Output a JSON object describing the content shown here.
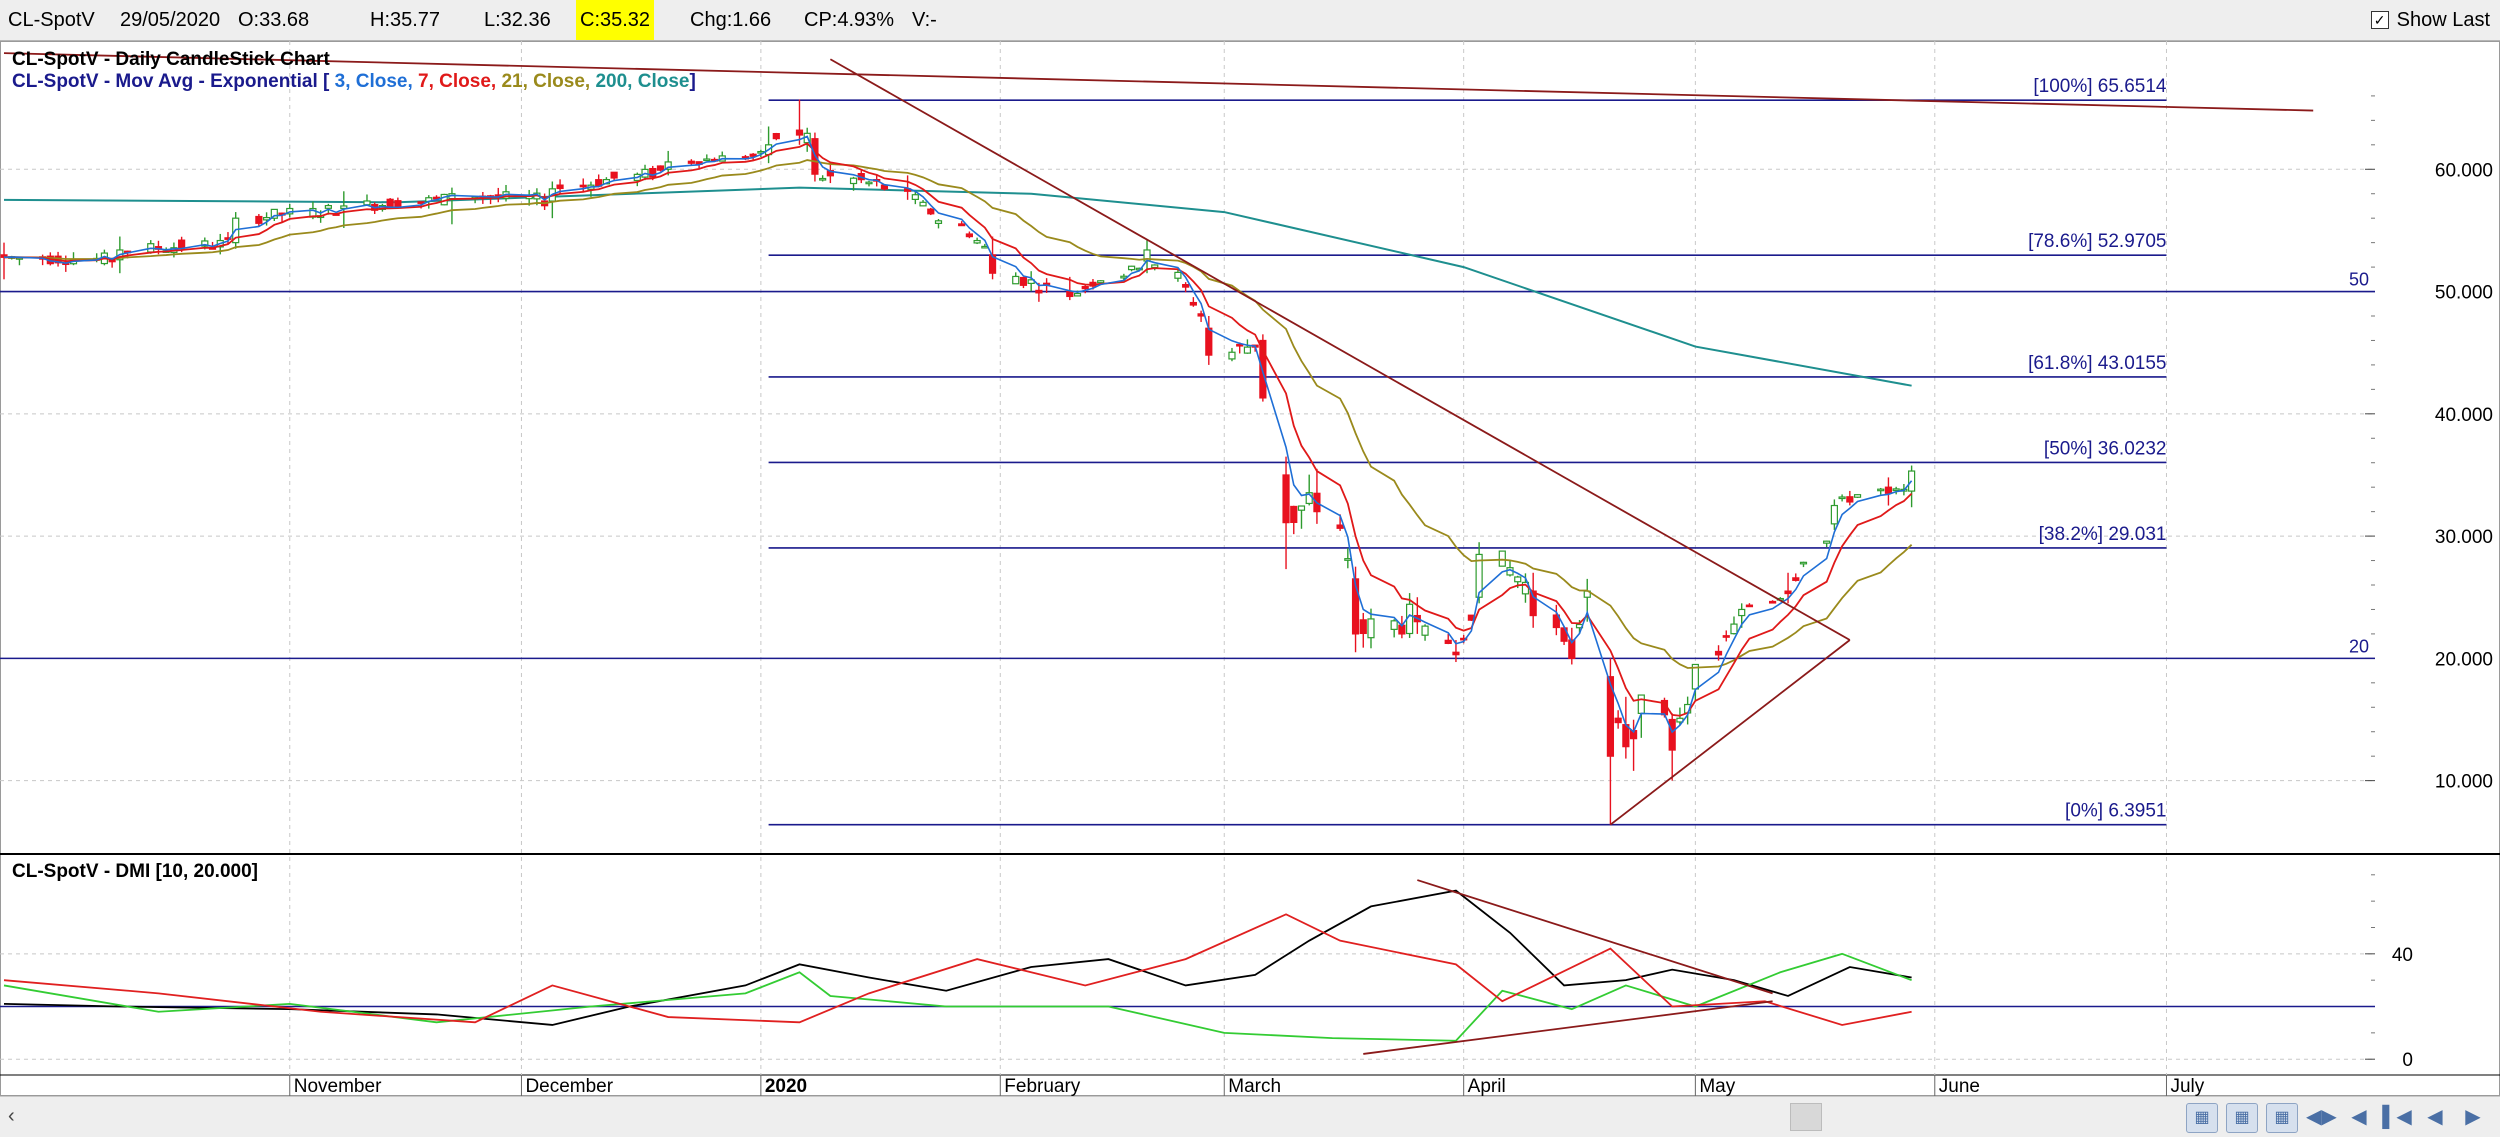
{
  "header": {
    "symbol": "CL-SpotV",
    "date": "29/05/2020",
    "open": "O:33.68",
    "high": "H:35.77",
    "low": "L:32.36",
    "close": "C:35.32",
    "change": "Chg:1.66",
    "change_pct": "CP:4.93%",
    "volume": "V:-",
    "show_last_label": "Show Last",
    "show_last_checked": true
  },
  "colors": {
    "up": "#2e9b2e",
    "down": "#e8111f",
    "ema3": "#1f6fd6",
    "ema7": "#e01919",
    "ema21": "#9a8a1c",
    "ema200": "#1e8f8f",
    "hline": "#1a1a8c",
    "trend": "#8b1a1a",
    "plus_di": "#33cc33",
    "minus_di": "#e02020",
    "adx": "#000000",
    "title_blue": "#1a1a8c"
  },
  "chart_data": [
    {
      "type": "candlestick",
      "title": "CL-SpotV - Daily CandleStick Chart",
      "legend": {
        "prefix": "CL-SpotV - Mov Avg - Exponential [",
        "items": [
          {
            "text": "3, Close,",
            "color": "#1f6fd6"
          },
          {
            "text": "7, Close,",
            "color": "#e01919"
          },
          {
            "text": "21, Close,",
            "color": "#9a8a1c"
          },
          {
            "text": "200, Close",
            "color": "#1e8f8f"
          }
        ],
        "suffix": "]"
      },
      "ylim": [
        4,
        70
      ],
      "y_ticks": [
        10,
        20,
        30,
        40,
        50,
        60
      ],
      "y_tick_labels": [
        "10.000",
        "20.000",
        "30.000",
        "40.000",
        "50.000",
        "60.000"
      ],
      "grid": true,
      "x_start": "2019-09-25",
      "x_end": "2020-07-28",
      "ohlc_anchors": [
        {
          "date": "2019-09-25",
          "open": 53.0,
          "high": 54.0,
          "low": 51.0,
          "close": 52.8
        },
        {
          "date": "2019-10-10",
          "open": 52.6,
          "high": 54.5,
          "low": 51.5,
          "close": 53.4
        },
        {
          "date": "2019-10-25",
          "open": 54.0,
          "high": 56.5,
          "low": 53.5,
          "close": 56.0
        },
        {
          "date": "2019-11-08",
          "open": 56.8,
          "high": 58.2,
          "low": 55.2,
          "close": 57.0
        },
        {
          "date": "2019-11-22",
          "open": 57.6,
          "high": 58.5,
          "low": 55.5,
          "close": 58.0
        },
        {
          "date": "2019-12-05",
          "open": 57.4,
          "high": 59.0,
          "low": 56.0,
          "close": 58.4
        },
        {
          "date": "2019-12-20",
          "open": 60.0,
          "high": 61.5,
          "low": 59.5,
          "close": 60.6
        },
        {
          "date": "2020-01-02",
          "open": 61.2,
          "high": 63.5,
          "low": 60.5,
          "close": 62.0
        },
        {
          "date": "2020-01-06",
          "open": 63.2,
          "high": 65.7,
          "low": 62.0,
          "close": 62.8
        },
        {
          "date": "2020-01-08",
          "open": 62.5,
          "high": 63.0,
          "low": 59.0,
          "close": 59.6
        },
        {
          "date": "2020-01-20",
          "open": 58.4,
          "high": 59.5,
          "low": 57.5,
          "close": 58.2
        },
        {
          "date": "2020-01-31",
          "open": 53.0,
          "high": 54.5,
          "low": 51.0,
          "close": 51.5
        },
        {
          "date": "2020-02-10",
          "open": 50.0,
          "high": 51.2,
          "low": 49.3,
          "close": 49.6
        },
        {
          "date": "2020-02-20",
          "open": 52.5,
          "high": 54.2,
          "low": 51.5,
          "close": 53.4
        },
        {
          "date": "2020-02-28",
          "open": 47.0,
          "high": 48.0,
          "low": 44.0,
          "close": 44.8
        },
        {
          "date": "2020-03-06",
          "open": 46.0,
          "high": 46.5,
          "low": 41.0,
          "close": 41.3
        },
        {
          "date": "2020-03-09",
          "open": 35.0,
          "high": 36.5,
          "low": 27.3,
          "close": 31.1
        },
        {
          "date": "2020-03-13",
          "open": 33.5,
          "high": 35.5,
          "low": 31.0,
          "close": 32.0
        },
        {
          "date": "2020-03-18",
          "open": 26.5,
          "high": 27.5,
          "low": 20.5,
          "close": 22.0
        },
        {
          "date": "2020-03-26",
          "open": 23.5,
          "high": 25.0,
          "low": 22.0,
          "close": 23.0
        },
        {
          "date": "2020-03-31",
          "open": 20.5,
          "high": 21.5,
          "low": 19.7,
          "close": 20.3
        },
        {
          "date": "2020-04-03",
          "open": 25.0,
          "high": 29.5,
          "low": 24.5,
          "close": 28.5
        },
        {
          "date": "2020-04-10",
          "open": 25.5,
          "high": 27.0,
          "low": 22.5,
          "close": 23.5
        },
        {
          "date": "2020-04-15",
          "open": 21.5,
          "high": 22.5,
          "low": 19.5,
          "close": 20.0
        },
        {
          "date": "2020-04-17",
          "open": 25.0,
          "high": 26.5,
          "low": 23.0,
          "close": 25.5
        },
        {
          "date": "2020-04-20",
          "open": 18.5,
          "high": 20.0,
          "low": 6.4,
          "close": 12.0
        },
        {
          "date": "2020-04-24",
          "open": 15.5,
          "high": 17.0,
          "low": 13.5,
          "close": 17.0
        },
        {
          "date": "2020-04-28",
          "open": 15.0,
          "high": 15.5,
          "low": 10.0,
          "close": 12.5
        },
        {
          "date": "2020-05-01",
          "open": 17.5,
          "high": 19.5,
          "low": 16.5,
          "close": 19.5
        },
        {
          "date": "2020-05-07",
          "open": 23.5,
          "high": 24.5,
          "low": 22.5,
          "close": 24.0
        },
        {
          "date": "2020-05-13",
          "open": 25.5,
          "high": 27.0,
          "low": 24.5,
          "close": 25.3
        },
        {
          "date": "2020-05-19",
          "open": 31.0,
          "high": 33.0,
          "low": 30.5,
          "close": 32.5
        },
        {
          "date": "2020-05-26",
          "open": 34.0,
          "high": 34.8,
          "low": 32.5,
          "close": 33.5
        },
        {
          "date": "2020-05-29",
          "open": 33.68,
          "high": 35.77,
          "low": 32.36,
          "close": 35.32
        }
      ],
      "ema200_anchors": [
        {
          "date": "2019-09-25",
          "value": 57.5
        },
        {
          "date": "2019-11-15",
          "value": 57.3
        },
        {
          "date": "2020-01-06",
          "value": 58.5
        },
        {
          "date": "2020-02-05",
          "value": 58.0
        },
        {
          "date": "2020-03-01",
          "value": 56.5
        },
        {
          "date": "2020-04-01",
          "value": 52.0
        },
        {
          "date": "2020-05-01",
          "value": 45.5
        },
        {
          "date": "2020-05-29",
          "value": 42.3
        }
      ],
      "fibonacci": {
        "x_from": "2020-01-02",
        "x_to": "2020-07-01",
        "levels": [
          {
            "label": "[100%] 65.6514",
            "value": 65.6514
          },
          {
            "label": "[78.6%] 52.9705",
            "value": 52.9705
          },
          {
            "label": "[61.8%] 43.0155",
            "value": 43.0155
          },
          {
            "label": "[50%] 36.0232",
            "value": 36.0232
          },
          {
            "label": "[38.2%] 29.031",
            "value": 29.031
          },
          {
            "label": "[0%] 6.3951",
            "value": 6.3951
          }
        ]
      },
      "horizontal_lines": [
        {
          "value": 50,
          "label": "50"
        },
        {
          "value": 20,
          "label": "20"
        }
      ],
      "trend_lines": [
        [
          {
            "date": "2019-09-25",
            "value": 69.5
          },
          {
            "date": "2020-07-20",
            "value": 64.8
          }
        ],
        [
          {
            "date": "2020-01-10",
            "value": 69.0
          },
          {
            "date": "2020-05-21",
            "value": 21.5
          }
        ],
        [
          {
            "date": "2020-04-20",
            "value": 6.4
          },
          {
            "date": "2020-05-21",
            "value": 21.5
          }
        ]
      ]
    },
    {
      "type": "line",
      "title": "CL-SpotV - DMI [10, 20.000]",
      "ylim": [
        -6,
        76
      ],
      "y_ticks": [
        0,
        40
      ],
      "y_tick_labels": [
        "0",
        "40"
      ],
      "reference_line": 20,
      "series": [
        {
          "key": "adx",
          "color": "#000000",
          "points": [
            {
              "date": "2019-09-25",
              "value": 21
            },
            {
              "date": "2019-10-10",
              "value": 20
            },
            {
              "date": "2019-11-01",
              "value": 19
            },
            {
              "date": "2019-11-20",
              "value": 17
            },
            {
              "date": "2019-12-05",
              "value": 13
            },
            {
              "date": "2019-12-15",
              "value": 20
            },
            {
              "date": "2019-12-30",
              "value": 28
            },
            {
              "date": "2020-01-06",
              "value": 36
            },
            {
              "date": "2020-01-15",
              "value": 31
            },
            {
              "date": "2020-01-25",
              "value": 26
            },
            {
              "date": "2020-02-05",
              "value": 35
            },
            {
              "date": "2020-02-15",
              "value": 38
            },
            {
              "date": "2020-02-25",
              "value": 28
            },
            {
              "date": "2020-03-05",
              "value": 32
            },
            {
              "date": "2020-03-12",
              "value": 45
            },
            {
              "date": "2020-03-20",
              "value": 58
            },
            {
              "date": "2020-03-31",
              "value": 64
            },
            {
              "date": "2020-04-07",
              "value": 48
            },
            {
              "date": "2020-04-14",
              "value": 28
            },
            {
              "date": "2020-04-22",
              "value": 30
            },
            {
              "date": "2020-04-28",
              "value": 34
            },
            {
              "date": "2020-05-06",
              "value": 30
            },
            {
              "date": "2020-05-13",
              "value": 24
            },
            {
              "date": "2020-05-21",
              "value": 35
            },
            {
              "date": "2020-05-29",
              "value": 31
            }
          ]
        },
        {
          "key": "plus_di",
          "color": "#33cc33",
          "points": [
            {
              "date": "2019-09-25",
              "value": 28
            },
            {
              "date": "2019-10-15",
              "value": 18
            },
            {
              "date": "2019-11-01",
              "value": 21
            },
            {
              "date": "2019-11-20",
              "value": 14
            },
            {
              "date": "2019-12-10",
              "value": 20
            },
            {
              "date": "2019-12-30",
              "value": 25
            },
            {
              "date": "2020-01-06",
              "value": 33
            },
            {
              "date": "2020-01-10",
              "value": 24
            },
            {
              "date": "2020-01-25",
              "value": 20
            },
            {
              "date": "2020-02-15",
              "value": 20
            },
            {
              "date": "2020-03-01",
              "value": 10
            },
            {
              "date": "2020-03-15",
              "value": 8
            },
            {
              "date": "2020-03-31",
              "value": 7
            },
            {
              "date": "2020-04-06",
              "value": 26
            },
            {
              "date": "2020-04-15",
              "value": 19
            },
            {
              "date": "2020-04-22",
              "value": 28
            },
            {
              "date": "2020-05-01",
              "value": 20
            },
            {
              "date": "2020-05-12",
              "value": 33
            },
            {
              "date": "2020-05-20",
              "value": 40
            },
            {
              "date": "2020-05-29",
              "value": 30
            }
          ]
        },
        {
          "key": "minus_di",
          "color": "#e02020",
          "points": [
            {
              "date": "2019-09-25",
              "value": 30
            },
            {
              "date": "2019-10-15",
              "value": 25
            },
            {
              "date": "2019-11-05",
              "value": 18
            },
            {
              "date": "2019-11-25",
              "value": 14
            },
            {
              "date": "2019-12-05",
              "value": 28
            },
            {
              "date": "2019-12-20",
              "value": 16
            },
            {
              "date": "2020-01-06",
              "value": 14
            },
            {
              "date": "2020-01-15",
              "value": 25
            },
            {
              "date": "2020-01-29",
              "value": 38
            },
            {
              "date": "2020-02-12",
              "value": 28
            },
            {
              "date": "2020-02-25",
              "value": 38
            },
            {
              "date": "2020-03-09",
              "value": 55
            },
            {
              "date": "2020-03-16",
              "value": 45
            },
            {
              "date": "2020-03-31",
              "value": 36
            },
            {
              "date": "2020-04-06",
              "value": 22
            },
            {
              "date": "2020-04-20",
              "value": 42
            },
            {
              "date": "2020-04-28",
              "value": 20
            },
            {
              "date": "2020-05-10",
              "value": 22
            },
            {
              "date": "2020-05-20",
              "value": 13
            },
            {
              "date": "2020-05-29",
              "value": 18
            }
          ]
        }
      ],
      "trend_lines": [
        [
          {
            "date": "2020-03-26",
            "value": 68
          },
          {
            "date": "2020-05-11",
            "value": 25
          }
        ],
        [
          {
            "date": "2020-03-19",
            "value": 2
          },
          {
            "date": "2020-05-11",
            "value": 22
          }
        ]
      ]
    }
  ],
  "x_axis": {
    "labels": [
      {
        "text": "November",
        "date": "2019-11-01"
      },
      {
        "text": "December",
        "date": "2019-12-01"
      },
      {
        "text": "2020",
        "date": "2020-01-01",
        "bold": true
      },
      {
        "text": "February",
        "date": "2020-02-01"
      },
      {
        "text": "March",
        "date": "2020-03-01"
      },
      {
        "text": "April",
        "date": "2020-04-01"
      },
      {
        "text": "May",
        "date": "2020-05-01"
      },
      {
        "text": "June",
        "date": "2020-06-01"
      },
      {
        "text": "July",
        "date": "2020-07-01"
      }
    ]
  },
  "navigation": {
    "icons": [
      "zoom-in-icon",
      "zoom-out-icon",
      "zoom-fit-icon",
      "scroll-both-icon",
      "first-icon",
      "prev-icon",
      "last-icon",
      "next-icon"
    ]
  }
}
